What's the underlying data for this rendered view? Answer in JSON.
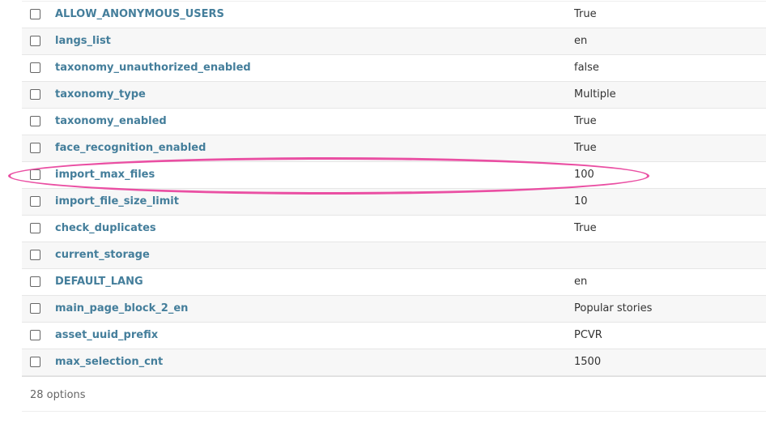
{
  "rows": [
    {
      "key": "ALLOW_ANONYMOUS_USERS",
      "value": "True"
    },
    {
      "key": "langs_list",
      "value": "en"
    },
    {
      "key": "taxonomy_unauthorized_enabled",
      "value": "false"
    },
    {
      "key": "taxonomy_type",
      "value": "Multiple"
    },
    {
      "key": "taxonomy_enabled",
      "value": "True"
    },
    {
      "key": "face_recognition_enabled",
      "value": "True"
    },
    {
      "key": "import_max_files",
      "value": "100"
    },
    {
      "key": "import_file_size_limit",
      "value": "10"
    },
    {
      "key": "check_duplicates",
      "value": "True"
    },
    {
      "key": "current_storage",
      "value": ""
    },
    {
      "key": "DEFAULT_LANG",
      "value": "en"
    },
    {
      "key": "main_page_block_2_en",
      "value": "Popular stories"
    },
    {
      "key": "asset_uuid_prefix",
      "value": "PCVR"
    },
    {
      "key": "max_selection_cnt",
      "value": "1500"
    }
  ],
  "footer": {
    "count": "28 options"
  },
  "highlight": {
    "row": "import_max_files",
    "color": "#ea4fa3"
  }
}
